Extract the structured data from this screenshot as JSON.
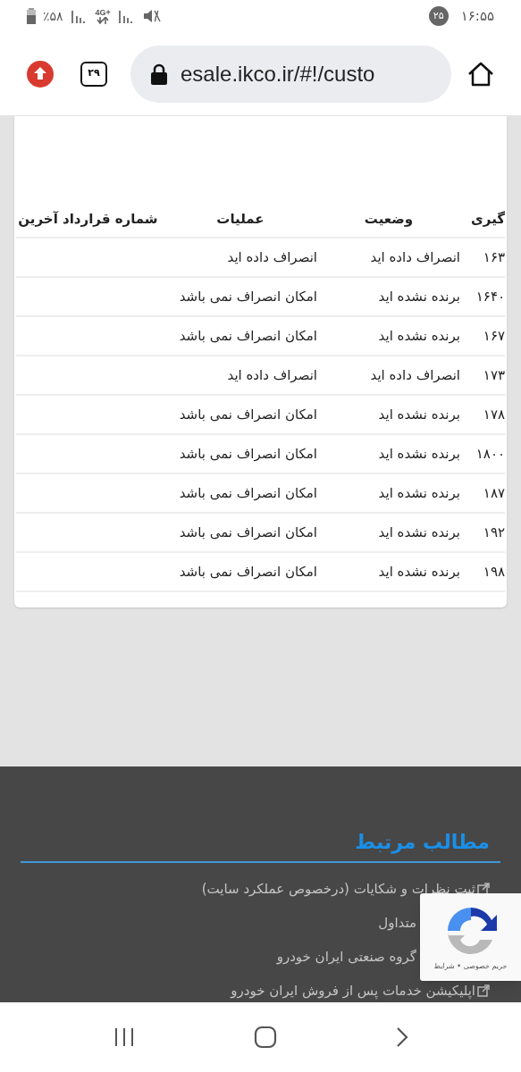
{
  "status_bar": {
    "battery": "٪۵۸",
    "network": "4G+",
    "notification_count": "۲۵",
    "time": "۱۶:۵۵"
  },
  "browser": {
    "tab_count": "۲۹",
    "url": "esale.ikco.ir/#!/custo"
  },
  "table": {
    "columns": [
      "گیری",
      "وضعیت",
      "عملیات",
      "شماره قرارداد آخرین"
    ],
    "rows": [
      {
        "cells": [
          "۱۶۳",
          "انصراف داده اید",
          "انصراف داده اید"
        ]
      },
      {
        "cells": [
          "۱۶۴۰",
          "برنده نشده اید",
          "امکان انصراف نمی باشد"
        ]
      },
      {
        "cells": [
          "۱۶۷",
          "برنده نشده اید",
          "امکان انصراف نمی باشد"
        ]
      },
      {
        "cells": [
          "۱۷۳",
          "انصراف داده اید",
          "انصراف داده اید"
        ]
      },
      {
        "cells": [
          "۱۷۸",
          "برنده نشده اید",
          "امکان انصراف نمی باشد"
        ]
      },
      {
        "cells": [
          "۱۸۰۰",
          "برنده نشده اید",
          "امکان انصراف نمی باشد"
        ]
      },
      {
        "cells": [
          "۱۸۷",
          "برنده نشده اید",
          "امکان انصراف نمی باشد"
        ]
      },
      {
        "cells": [
          "۱۹۲",
          "برنده نشده اید",
          "امکان انصراف نمی باشد"
        ]
      },
      {
        "cells": [
          "۱۹۸",
          "برنده نشده اید",
          "امکان انصراف نمی باشد"
        ]
      }
    ]
  },
  "related": {
    "title": "مطالب مرتبط",
    "links": [
      {
        "label": "ثبت نظرات و شکایات (درخصوص عملکرد سایت)",
        "icon": true
      },
      {
        "label": "متداول",
        "icon": false
      },
      {
        "label": "گروه صنعتی ایران خودرو",
        "icon": false
      },
      {
        "label": "اپلیکیشن خدمات پس از فروش ایران خودرو",
        "icon": true
      }
    ]
  },
  "recaptcha": {
    "text": "حریم خصوصی • شرایط"
  }
}
